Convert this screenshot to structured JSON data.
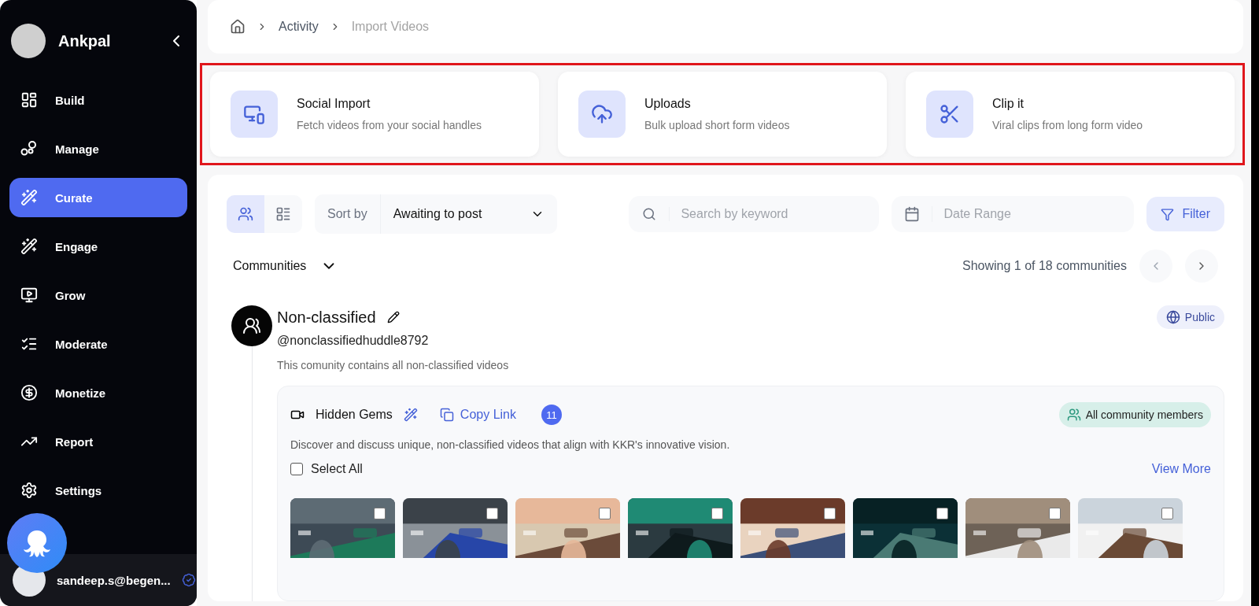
{
  "brand": {
    "name": "Ankpal"
  },
  "nav": [
    {
      "label": "Build",
      "selected": false
    },
    {
      "label": "Manage",
      "selected": false
    },
    {
      "label": "Curate",
      "selected": true
    },
    {
      "label": "Engage",
      "selected": false
    },
    {
      "label": "Grow",
      "selected": false
    },
    {
      "label": "Moderate",
      "selected": false
    },
    {
      "label": "Monetize",
      "selected": false
    },
    {
      "label": "Report",
      "selected": false
    },
    {
      "label": "Settings",
      "selected": false
    }
  ],
  "user": {
    "email": "sandeep.s@begen...",
    "verified": true
  },
  "breadcrumb": [
    "Activity",
    "Import Videos"
  ],
  "import_options": [
    {
      "kind": "social",
      "title": "Social Import",
      "description": "Fetch videos from your social handles"
    },
    {
      "kind": "upload",
      "title": "Uploads",
      "description": "Bulk upload short form videos"
    },
    {
      "kind": "clip",
      "title": "Clip it",
      "description": "Viral clips from long form video"
    }
  ],
  "toolbar": {
    "views": [
      {
        "kind": "communities",
        "selected": true
      },
      {
        "kind": "feed",
        "selected": false
      }
    ],
    "sort_label": "Sort by",
    "sort_value": "Awaiting to post",
    "search_placeholder": "Search by keyword",
    "date_placeholder": "Date Range",
    "filter_label": "Filter"
  },
  "communities_header": {
    "label": "Communities",
    "showing": "Showing 1 of 18 communities"
  },
  "community": {
    "name": "Non-classified",
    "handle": "@nonclassifiedhuddle8792",
    "description": "This comunity contains all non-classified videos",
    "visibility": "Public"
  },
  "group": {
    "title": "Hidden Gems",
    "copy_link": "Copy Link",
    "count": "11",
    "audience": "All community members",
    "description": "Discover and discuss unique, non-classified videos that align with KKR's innovative vision.",
    "select_all": {
      "label": "Select All",
      "checked": false
    },
    "view_more": "View More"
  }
}
